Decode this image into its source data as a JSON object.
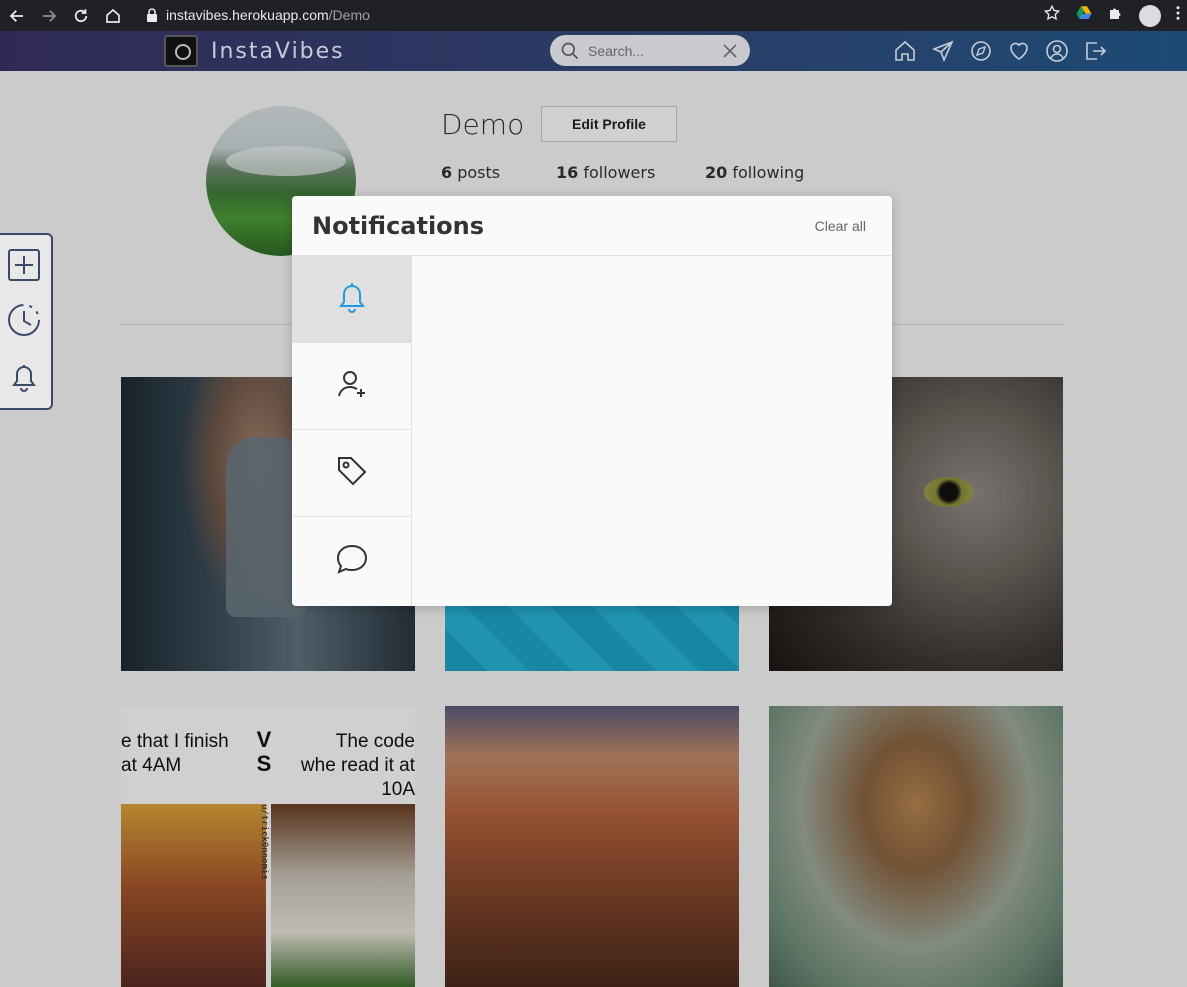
{
  "browser": {
    "url_host": "instavibes.herokuapp.com",
    "url_path": "/Demo"
  },
  "header": {
    "brand": "InstaVibes",
    "search_placeholder": "Search...",
    "nav_icons": [
      "home-icon",
      "direct-send-icon",
      "explore-icon",
      "heart-icon",
      "profile-icon",
      "logout-icon"
    ]
  },
  "side_tools": {
    "icons": [
      "add-post-icon",
      "history-icon",
      "notifications-bell-icon"
    ]
  },
  "profile": {
    "username": "Demo",
    "edit_label": "Edit Profile",
    "posts_count": "6",
    "posts_label": "posts",
    "followers_count": "16",
    "followers_label": "followers",
    "following_count": "20",
    "following_label": "following"
  },
  "grid": {
    "meme_left": "e that I finish at 4AM",
    "meme_vs": "VS",
    "meme_right": "The code whe read it at 10A",
    "meme_credit": "u/trick0nnomis"
  },
  "notifications": {
    "title": "Notifications",
    "clear_label": "Clear all",
    "active_tab": 0,
    "tabs": [
      "bell-icon",
      "follow-request-icon",
      "tag-icon",
      "comment-icon"
    ],
    "accent_color": "#1b9ce8"
  }
}
